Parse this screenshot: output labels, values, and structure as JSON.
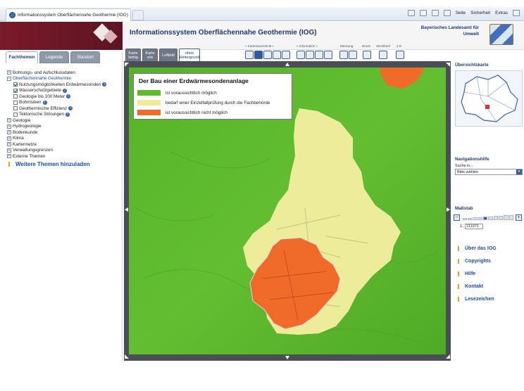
{
  "browser": {
    "tab_title": "Informationssystem Oberflächennahe Geothermie (IOG)",
    "commands": [
      "Seite",
      "Sicherheit",
      "Extras"
    ]
  },
  "header": {
    "title": "Informationssystem Oberflächennahe Geothermie (IOG)",
    "authority_line1": "Bayerisches Landesamt für",
    "authority_line2": "Umwelt"
  },
  "left_tabs": [
    {
      "label": "Fachthemen",
      "active": true
    },
    {
      "label": "Legende",
      "active": false
    },
    {
      "label": "Standort",
      "active": false
    }
  ],
  "tree": {
    "bohrung": "Bohrungs- und Aufschlussdaten",
    "geothermie": "Oberflächennahe Geothermie",
    "nutzung": "Nutzungsmöglichkeiten Erdwärmesonden",
    "wasserschutz": "Wasserschutzgebiete",
    "geologie100": "Geologie bis 100 Meter",
    "bohrrisiken": "Bohrrisiken",
    "effizienz": "Geothermische Effizienz",
    "stoerungen": "Tektonische Störungen",
    "geologie": "Geologie",
    "hydrogeologie": "Hydrogeologie",
    "bodenkunde": "Bodenkunde",
    "klima": "Klima",
    "kartennetze": "Kartennetze",
    "verwaltung": "Verwaltungsgrenzen",
    "externe": "Externe Themen",
    "add_themes": "Weitere Themen hinzuladen"
  },
  "map_toolbar": {
    "btn_karte_farbig": "Karte farbig",
    "btn_karte_sw": "Karte s/w",
    "btn_luftbild": "Luftbild",
    "btn_ohne": "ohne Hintergrund",
    "grp_kartenausschnitt": "« Kartenausschnitt »",
    "grp_information": "« Information »",
    "grp_messung": "Messung",
    "grp_druck": "Druck",
    "grp_steckbrief": "Steckbrief",
    "grp_3d": "3 D"
  },
  "legend": {
    "title": "Der Bau einer Erdwärmesondenanlage",
    "items": [
      {
        "label": "ist voraussichtlich möglich",
        "color": "#5fba2e"
      },
      {
        "label": "bedarf einer Einzelfallprüfung durch die Fachbehörde",
        "color": "#ecec9a"
      },
      {
        "label": "ist voraussichtlich nicht möglich",
        "color": "#f06a2a"
      }
    ]
  },
  "right_panel": {
    "overview_title": "Übersichtskarte",
    "nav_title": "Navigationshilfe",
    "nav_search_label": "Suche in...",
    "nav_select_value": "Bitte wählen",
    "scale_title": "Maßstab",
    "scale_prefix": "1:",
    "scale_value": "211071",
    "links": [
      "Über das IOG",
      "Copyrights",
      "Hilfe",
      "Kontakt",
      "Lesezeichen"
    ]
  },
  "colors": {
    "header_brand": "#6e1828",
    "title_blue": "#1e3a78",
    "map_green": "#5fba2e",
    "map_yellow": "#ecec9a",
    "map_red": "#f06a2a"
  }
}
